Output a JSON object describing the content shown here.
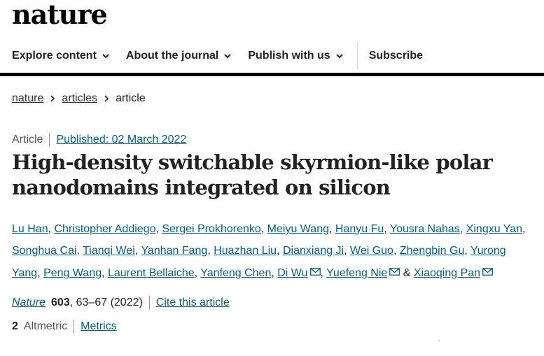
{
  "site": {
    "logo": "nature"
  },
  "nav": {
    "explore": "Explore content",
    "about": "About the journal",
    "publish": "Publish with us",
    "subscribe": "Subscribe"
  },
  "breadcrumb": [
    "nature",
    "articles",
    "article"
  ],
  "article": {
    "type": "Article",
    "published": "Published: 02 March 2022",
    "title": "High-density switchable skyrmion-like polar nanodomains integrated on silicon",
    "authors": [
      "Lu Han",
      "Christopher Addiego",
      "Sergei Prokhorenko",
      "Meiyu Wang",
      "Hanyu Fu",
      "Yousra Nahas",
      "Xingxu Yan",
      "Songhua Cai",
      "Tianqi Wei",
      "Yanhan Fang",
      "Huazhan Liu",
      "Dianxiang Ji",
      "Wei Guo",
      "Zhengbin Gu",
      "Yurong Yang",
      "Peng Wang",
      "Laurent Bellaiche",
      "Yanfeng Chen",
      "Di Wu",
      "Yuefeng Nie",
      "Xiaoqing Pan"
    ],
    "journal": "Nature",
    "volume": "603",
    "pages": ", 63–67 (2022)",
    "cite_label": "Cite this article"
  },
  "metrics": {
    "altmetric_count": "2",
    "altmetric_label": "Altmetric",
    "metrics_link": "Metrics"
  },
  "colors": {
    "link": "#025e8d",
    "text": "#222222",
    "rule": "#000000"
  }
}
